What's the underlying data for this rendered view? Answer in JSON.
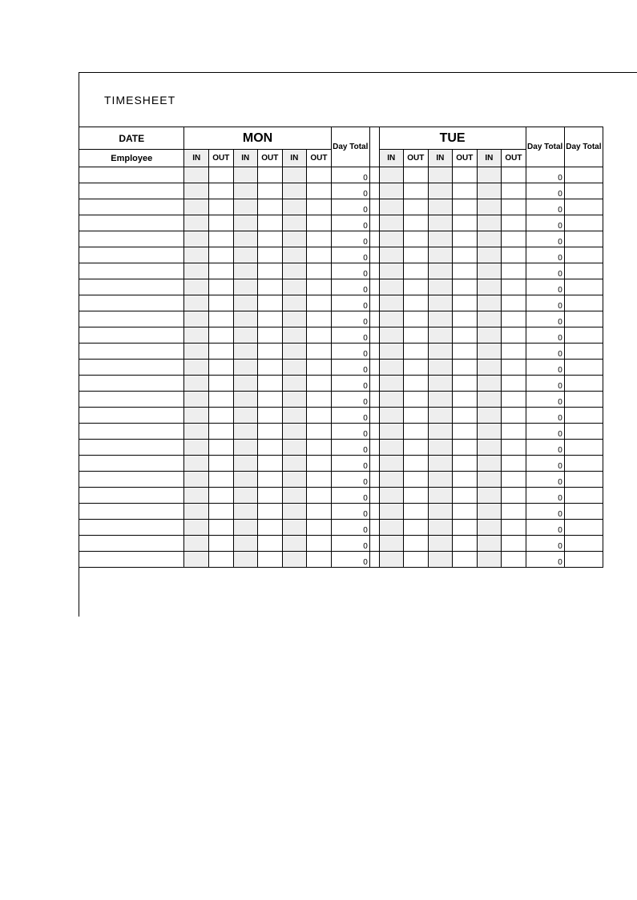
{
  "title": "TIMESHEET",
  "header": {
    "date": "DATE",
    "employee": "Employee",
    "days": [
      "MON",
      "TUE"
    ],
    "in": "IN",
    "out": "OUT",
    "day_total": "Day Total"
  },
  "num_rows": 25,
  "day_total_value": "0"
}
